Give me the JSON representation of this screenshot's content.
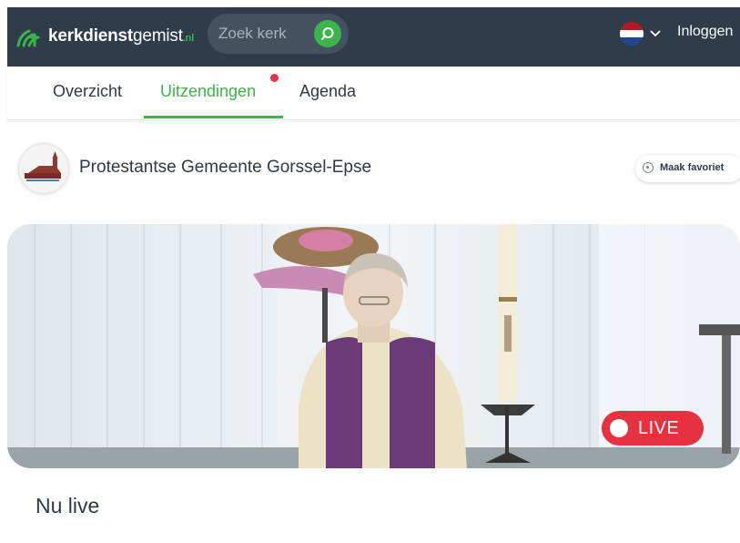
{
  "header": {
    "logo": {
      "bold": "kerkdienst",
      "light": "gemist",
      "tld": ".nl"
    },
    "search": {
      "placeholder": "Zoek kerk"
    },
    "language": {
      "flag": "nl-flag",
      "colors": [
        "#ae1c28",
        "#ffffff",
        "#21468b"
      ]
    },
    "login_label": "Inloggen"
  },
  "tabs": [
    {
      "label": "Overzicht",
      "active": false
    },
    {
      "label": "Uitzendingen",
      "active": true,
      "notification": true
    },
    {
      "label": "Agenda",
      "active": false
    }
  ],
  "church": {
    "name": "Protestantse Gemeente Gorssel-Epse",
    "favorite_label": "Maak favoriet"
  },
  "video": {
    "live_label": "LIVE",
    "is_live": true
  },
  "section": {
    "title": "Nu live"
  },
  "colors": {
    "header_bg": "#2f3d4b",
    "accent": "#3bb54a",
    "live": "#e8313f",
    "text": "#2d3a46"
  }
}
